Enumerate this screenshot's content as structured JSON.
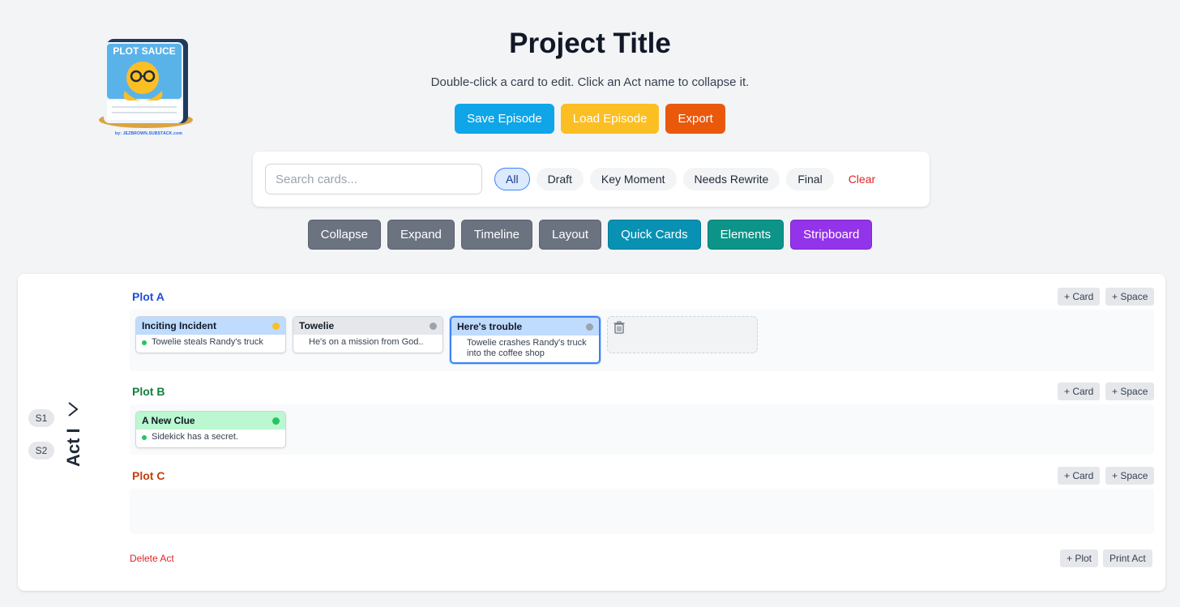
{
  "header": {
    "title": "Project Title",
    "subtitle": "Double-click a card to edit. Click an Act name to collapse it.",
    "logo_text": "PLOT SAUCE",
    "logo_credit": "by: JEZBROWN.SUBSTACK.com"
  },
  "top_buttons": {
    "save": "Save Episode",
    "load": "Load Episode",
    "export": "Export"
  },
  "filter": {
    "search_placeholder": "Search cards...",
    "chips": [
      "All",
      "Draft",
      "Key Moment",
      "Needs Rewrite",
      "Final"
    ],
    "active_chip": "All",
    "clear": "Clear"
  },
  "tools": {
    "collapse": "Collapse",
    "expand": "Expand",
    "timeline": "Timeline",
    "layout": "Layout",
    "quick_cards": "Quick Cards",
    "elements": "Elements",
    "stripboard": "Stripboard"
  },
  "act": {
    "name": "Act I",
    "scenes": [
      "S1",
      "S2"
    ],
    "delete_label": "Delete Act",
    "add_plot_label": "+ Plot",
    "print_label": "Print Act",
    "plots": [
      {
        "name": "Plot A",
        "add_card": "+ Card",
        "add_space": "+ Space",
        "cards": [
          {
            "title": "Inciting Incident",
            "text": "Towelie steals Randy's truck",
            "status_color": "#fbbf24",
            "head_color": "#bfdbfe",
            "scene_dot_color": "#22c55e"
          },
          {
            "title": "Towelie",
            "text": "He's on a mission from God..",
            "status_color": "#9ca3af",
            "head_color": "#e5e7eb",
            "scene_dot_color": ""
          },
          {
            "title": "Here's trouble",
            "text": "Towelie crashes Randy's truck into the coffee shop",
            "status_color": "#9ca3af",
            "head_color": "#bfdbfe",
            "scene_dot_color": ""
          }
        ]
      },
      {
        "name": "Plot B",
        "add_card": "+ Card",
        "add_space": "+ Space",
        "cards": [
          {
            "title": "A New Clue",
            "text": "Sidekick has a secret.",
            "status_color": "#22c55e",
            "head_color": "#bbf7d0",
            "scene_dot_color": "#22c55e"
          }
        ]
      },
      {
        "name": "Plot C",
        "add_card": "+ Card",
        "add_space": "+ Space",
        "cards": []
      }
    ]
  }
}
